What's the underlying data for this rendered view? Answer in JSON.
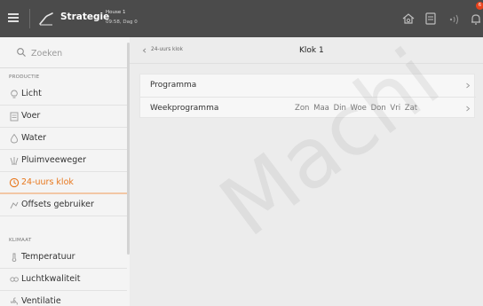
{
  "topbar": {
    "title": "Strategie",
    "house_name": "House 1",
    "house_time": "09:58, Dag 0",
    "notification_count": "6"
  },
  "sidebar": {
    "search_placeholder": "Zoeken",
    "sections": [
      {
        "heading": "PRODUCTIE",
        "items": [
          {
            "label": "Licht",
            "icon": "lightbulb-icon"
          },
          {
            "label": "Voer",
            "icon": "feed-icon"
          },
          {
            "label": "Water",
            "icon": "drop-icon"
          },
          {
            "label": "Pluimveeweger",
            "icon": "scale-icon"
          },
          {
            "label": "24-uurs klok",
            "icon": "clock-icon",
            "active": true
          },
          {
            "label": "Offsets gebruiker",
            "icon": "offset-icon"
          }
        ]
      },
      {
        "heading": "KLIMAAT",
        "items": [
          {
            "label": "Temperatuur",
            "icon": "thermometer-icon"
          },
          {
            "label": "Luchtkwaliteit",
            "icon": "co2-icon"
          },
          {
            "label": "Ventilatie",
            "icon": "fan-icon"
          }
        ]
      }
    ],
    "active_color": "#e8771c"
  },
  "main": {
    "breadcrumb": "24-uurs klok",
    "title": "Klok 1",
    "rows": [
      {
        "label": "Programma"
      },
      {
        "label": "Weekprogramma",
        "days": [
          "Zon",
          "Maa",
          "Din",
          "Woe",
          "Don",
          "Vri",
          "Zat"
        ]
      }
    ]
  },
  "watermark": "Machi"
}
